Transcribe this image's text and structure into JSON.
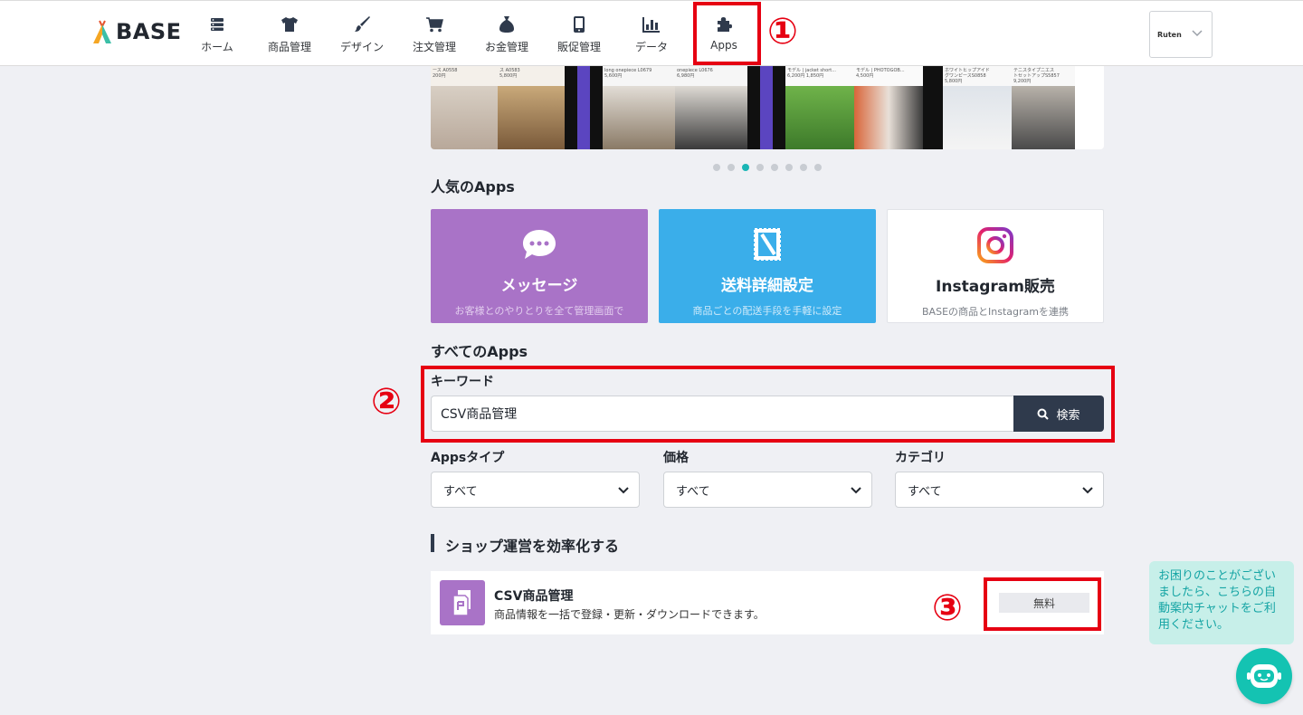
{
  "header": {
    "logo_text": "BASE",
    "nav": [
      {
        "label": "ホーム",
        "icon": "home-list-icon"
      },
      {
        "label": "商品管理",
        "icon": "tshirt-icon"
      },
      {
        "label": "デザイン",
        "icon": "brush-icon"
      },
      {
        "label": "注文管理",
        "icon": "cart-icon"
      },
      {
        "label": "お金管理",
        "icon": "money-bag-icon"
      },
      {
        "label": "販促管理",
        "icon": "smartphone-icon"
      },
      {
        "label": "データ",
        "icon": "bar-chart-icon"
      },
      {
        "label": "Apps",
        "icon": "puzzle-icon"
      }
    ],
    "shop_badge": "Ruten"
  },
  "annotations": {
    "one": "①",
    "two": "②",
    "three": "③"
  },
  "banner": {
    "prices": [
      "ース A0558\n200円",
      "ス A0583\n5,800円",
      "long onepiece L0679\n5,600円",
      "onepiece L0676\n6,980円",
      "モデル | jacket short...\n6,200円 1,850円",
      "モデル | PHOTOGOB...\n4,500円",
      "ホワイトヒップアイド\nグワンピースS0858\n5,800円",
      "テニスタイプニエス\nトセットアップS5857\n9,200円"
    ]
  },
  "popular": {
    "title": "人気のApps",
    "apps": [
      {
        "name": "メッセージ",
        "desc": "お客様とのやりとりを全て管理画面で",
        "color": "#a973c7"
      },
      {
        "name": "送料詳細設定",
        "desc": "商品ごとの配送手段を手軽に設定",
        "color": "#3aaeea"
      },
      {
        "name": "Instagram販売",
        "desc": "BASEの商品とInstagramを連携",
        "color": "#ffffff"
      }
    ]
  },
  "all_apps": {
    "title": "すべてのApps",
    "keyword_label": "キーワード",
    "keyword_value": "CSV商品管理",
    "search_label": "検索",
    "filters": [
      {
        "label": "Appsタイプ",
        "value": "すべて"
      },
      {
        "label": "価格",
        "value": "すべて"
      },
      {
        "label": "カテゴリ",
        "value": "すべて"
      }
    ]
  },
  "category": {
    "title": "ショップ運営を効率化する",
    "items": [
      {
        "name": "CSV商品管理",
        "desc": "商品情報を一括で登録・更新・ダウンロードできます。",
        "price": "無料"
      }
    ]
  },
  "chat": {
    "message": "お困りのことがございましたら、こちらの自動案内チャットをご利用ください。"
  },
  "colors": {
    "accent_red": "#e60012",
    "teal": "#14c3b2",
    "navy": "#2f3a4c"
  }
}
